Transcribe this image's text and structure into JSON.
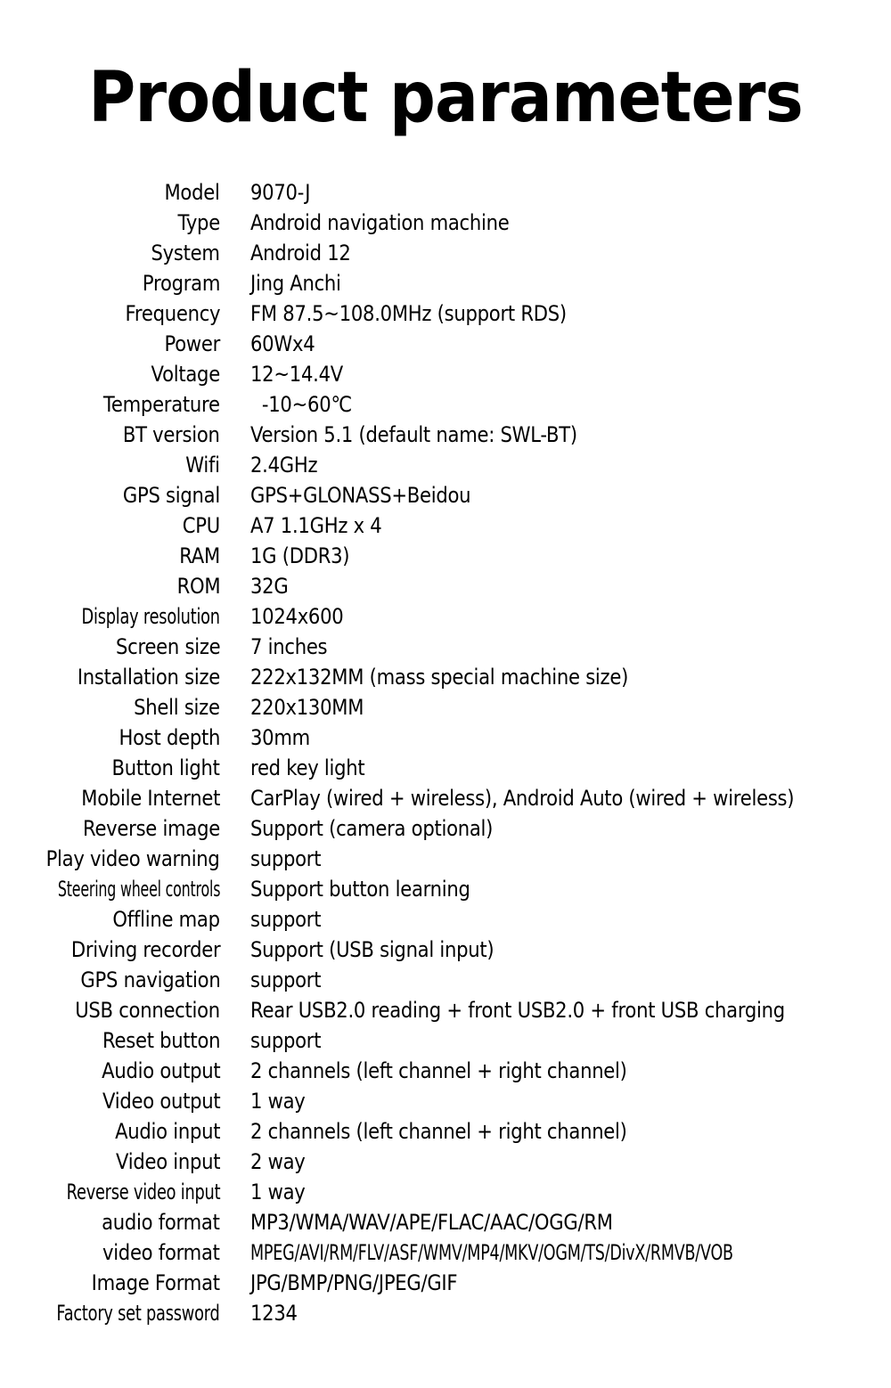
{
  "page": {
    "title": "Product parameters"
  },
  "specs": [
    {
      "label": "Model",
      "value": "9070-J"
    },
    {
      "label": "Type",
      "value": "Android navigation machine"
    },
    {
      "label": "System",
      "value": "Android 12"
    },
    {
      "label": "Program",
      "value": "Jing Anchi"
    },
    {
      "label": "Frequency",
      "value": "FM 87.5~108.0MHz (support RDS)"
    },
    {
      "label": "Power",
      "value": "60Wx4"
    },
    {
      "label": "Voltage",
      "value": "12~14.4V"
    },
    {
      "label": "Temperature",
      "value": "  -10~60℃"
    },
    {
      "label": "BT version",
      "value": "Version 5.1 (default name: SWL-BT)"
    },
    {
      "label": "Wifi",
      "value": "2.4GHz"
    },
    {
      "label": "GPS signal",
      "value": "GPS+GLONASS+Beidou"
    },
    {
      "label": "CPU",
      "value": "A7 1.1GHz x 4"
    },
    {
      "label": "RAM",
      "value": "1G (DDR3)"
    },
    {
      "label": "ROM",
      "value": "32G"
    },
    {
      "label": "Display resolution",
      "value": "1024x600"
    },
    {
      "label": "Screen size",
      "value": "7 inches"
    },
    {
      "label": "Installation size",
      "value": "222x132MM (mass special machine size)"
    },
    {
      "label": "Shell size",
      "value": "220x130MM"
    },
    {
      "label": "Host depth",
      "value": "30mm"
    },
    {
      "label": "Button light",
      "value": "red key light"
    },
    {
      "label": "Mobile Internet",
      "value": "CarPlay (wired + wireless), Android Auto (wired + wireless)"
    },
    {
      "label": "Reverse image",
      "value": "Support (camera optional)"
    },
    {
      "label": "Play video warning",
      "value": "support"
    },
    {
      "label": "Steering wheel controls",
      "value": "Support button learning"
    },
    {
      "label": "Offline map",
      "value": "support"
    },
    {
      "label": "Driving recorder",
      "value": "Support (USB signal input)"
    },
    {
      "label": "GPS navigation",
      "value": "support"
    },
    {
      "label": "USB connection",
      "value": "Rear USB2.0 reading + front USB2.0 + front USB charging"
    },
    {
      "label": "Reset button",
      "value": "support"
    },
    {
      "label": "Audio output",
      "value": "2 channels (left channel + right channel)"
    },
    {
      "label": "Video output",
      "value": "1 way"
    },
    {
      "label": "Audio input",
      "value": "2 channels (left channel + right channel)"
    },
    {
      "label": "Video input",
      "value": "2 way"
    },
    {
      "label": "Reverse video input",
      "value": "1 way"
    },
    {
      "label": "audio format",
      "value": "MP3/WMA/WAV/APE/FLAC/AAC/OGG/RM"
    },
    {
      "label": "video format",
      "value": "MPEG/AVI/RM/FLV/ASF/WMV/MP4/MKV/OGM/TS/DivX/RMVB/VOB"
    },
    {
      "label": "Image Format",
      "value": "JPG/BMP/PNG/JPEG/GIF"
    },
    {
      "label": "Factory set password",
      "value": "1234"
    }
  ]
}
